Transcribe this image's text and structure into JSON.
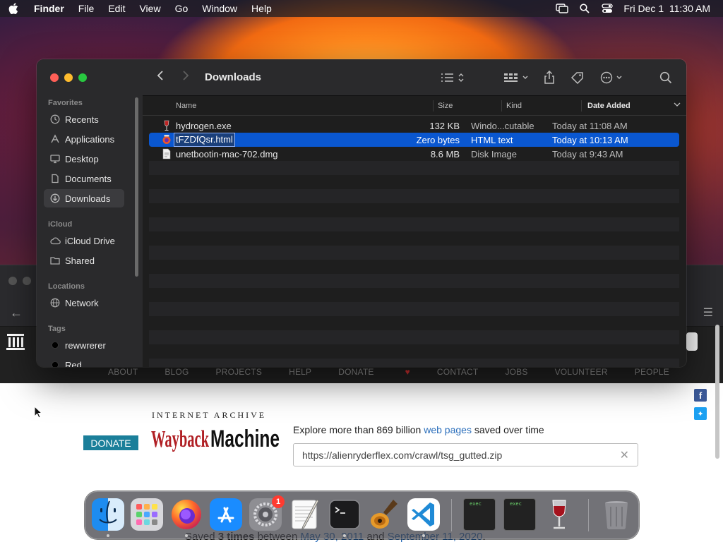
{
  "menubar": {
    "app_name": "Finder",
    "menus": [
      "File",
      "Edit",
      "View",
      "Go",
      "Window",
      "Help"
    ],
    "clock": "Fri Dec 1  11:30 AM"
  },
  "finder": {
    "title": "Downloads",
    "sidebar": {
      "favorites_label": "Favorites",
      "favorites": [
        {
          "label": "Recents",
          "icon": "clock-icon"
        },
        {
          "label": "Applications",
          "icon": "applications-icon"
        },
        {
          "label": "Desktop",
          "icon": "desktop-icon"
        },
        {
          "label": "Documents",
          "icon": "document-icon"
        },
        {
          "label": "Downloads",
          "icon": "download-icon",
          "selected": true
        }
      ],
      "icloud_label": "iCloud",
      "icloud": [
        {
          "label": "iCloud Drive",
          "icon": "cloud-icon"
        },
        {
          "label": "Shared",
          "icon": "shared-folder-icon"
        }
      ],
      "locations_label": "Locations",
      "locations": [
        {
          "label": "Network",
          "icon": "globe-icon"
        }
      ],
      "tags_label": "Tags",
      "tags": [
        {
          "label": "rewwrerer",
          "color": "#000000"
        },
        {
          "label": "Red",
          "color": "#000000"
        }
      ]
    },
    "columns": {
      "name": "Name",
      "size": "Size",
      "kind": "Kind",
      "date": "Date Added"
    },
    "files": [
      {
        "name": "hydrogen.exe",
        "size": "132 KB",
        "kind": "Windo...cutable",
        "date": "Today at 11:08 AM"
      },
      {
        "name": "tFZDfQsr.html",
        "size": "Zero bytes",
        "kind": "HTML text",
        "date": "Today at 10:13 AM",
        "selected": true
      },
      {
        "name": "unetbootin-mac-702.dmg",
        "size": "8.6 MB",
        "kind": "Disk Image",
        "date": "Today at 9:43 AM"
      }
    ]
  },
  "browser": {
    "nav": [
      "ABOUT",
      "BLOG",
      "PROJECTS",
      "HELP",
      "DONATE",
      "CONTACT",
      "JOBS",
      "VOLUNTEER",
      "PEOPLE"
    ],
    "donate_button": "DONATE",
    "ia_title": "INTERNET ARCHIVE",
    "logo_text": "WaybackMachine",
    "explore_prefix": "Explore more than 869 billion ",
    "explore_link": "web pages",
    "explore_suffix": " saved over time",
    "url_value": "https://alienryderflex.com/crawl/tsg_gutted.zip",
    "saved_prefix": "Saved ",
    "saved_count": "3 times",
    "saved_mid": " between ",
    "saved_start": "May 30, 2011",
    "saved_and": " and ",
    "saved_end": "September 11, 2020",
    "saved_end_punct": "."
  },
  "dock": {
    "badge_count": "1",
    "apps": [
      "finder-icon",
      "launchpad-icon",
      "firefox-icon",
      "app-store-icon",
      "system-settings-icon",
      "textedit-icon",
      "terminal-icon",
      "garageband-icon",
      "vscode-icon",
      "exec-window-icon",
      "exec-window-icon",
      "wine-icon",
      "trash-icon"
    ],
    "exec_label": "exec"
  }
}
